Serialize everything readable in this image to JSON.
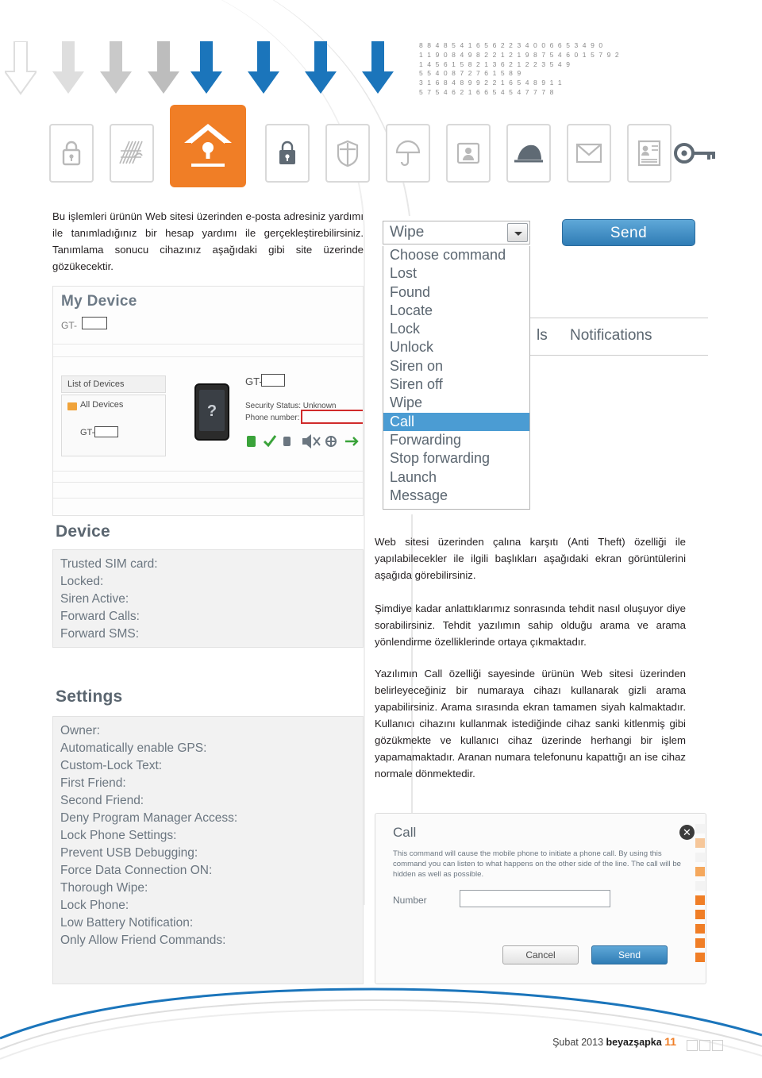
{
  "document": {
    "digits": [
      "8 8 4 8 5 4 1 6 5 6 2 2 3 4 0 0 6 6 5 3 4 9 0",
      "1 1 9 0 8 4 9 8 2 2 1 2 1 9 8 7 5 4 6 0 1 5 7 9 2",
      "1 4 5 6 1 5 8 2 1 3 6 2 1 2 2 3 5 4 9",
      "5 5 4 0 8 7 2 7 6 1 5 8 9",
      "3 1 6 8 4 8 9 9 2 2 1 6 5 4 8 9 1 1",
      "5 7 5 4 6 2 1 6 6 5 4 5 4 7 7 7 8"
    ],
    "icons": [
      "lock-icon",
      "maze-icon",
      "home-shield-icon",
      "padlock-icon",
      "shield-icon",
      "umbrella-icon",
      "portrait-folder-icon",
      "hat-icon",
      "envelope-icon",
      "id-card-icon",
      "key-icon"
    ],
    "intro": "Bu işlemleri ürünün Web sitesi üzerinden e-posta adresiniz yardımı ile tanımladığınız bir hesap yardımı ile gerçekleştirebilirsiniz. Tanımlama sonucu cihazınız aşağıdaki gibi site üzerinde gözükecektir.",
    "paragraphs": [
      "Web sitesi üzerinden çalına karşıtı (Anti Theft) özelliği ile yapılabilecekler ile ilgili başlıkları aşağıdaki ekran görüntülerini aşağıda görebilirsiniz.",
      "Şimdiye kadar anlattıklarımız sonrasında tehdit nasıl oluşuyor diye sorabilirsiniz. Tehdit yazılımın sahip olduğu arama ve arama yönlendirme özelliklerinde ortaya çıkmaktadır.",
      "Yazılımın Call özelliği sayesinde ürünün Web sitesi üzerinden belirleyeceğiniz bir numaraya cihazı kullanarak gizli arama yapabilirsiniz. Arama sırasında ekran tamamen siyah kalmaktadır. Kullanıcı cihazını kullanmak istediğinde cihaz sanki kitlenmiş gibi gözükmekte ve kullanıcı cihaz üzerinde herhangi bir işlem yapamamaktadır. Aranan numara telefonunu kapattığı an ise cihaz normale dönmektedir."
    ]
  },
  "screenshot_devices": {
    "title": "My Device",
    "subtitle": "GT-",
    "panel_header": "List of Devices",
    "all_devices": "All Devices",
    "device_item": "GT-",
    "phone_label": "GT-",
    "security_status": "Security Status: Unknown",
    "phone_number": "Phone number:"
  },
  "screenshot_dropdown": {
    "selected_value": "Wipe",
    "send_button": "Send",
    "options": [
      "Choose command",
      "Lost",
      "Found",
      "Locate",
      "Lock",
      "Unlock",
      "Siren on",
      "Siren off",
      "Wipe",
      "Call",
      "Forwarding",
      "Stop forwarding",
      "Launch",
      "Message"
    ],
    "highlighted_option": "Call",
    "tab_partial": "ls",
    "tab_notifications": "Notifications"
  },
  "screenshot_device_settings": {
    "device_header": "Device",
    "device_rows": [
      "Trusted SIM card:",
      "Locked:",
      "Siren Active:",
      "Forward Calls:",
      "Forward SMS:"
    ],
    "settings_header": "Settings",
    "settings_rows": [
      "Owner:",
      "Automatically enable GPS:",
      "Custom-Lock Text:",
      "First Friend:",
      "Second Friend:",
      "Deny Program Manager Access:",
      "Lock Phone Settings:",
      "Prevent USB Debugging:",
      "Force Data Connection ON:",
      "Thorough Wipe:",
      "Lock Phone:",
      "Low Battery Notification:",
      "Only Allow Friend Commands:"
    ]
  },
  "screenshot_call_dialog": {
    "title": "Call",
    "close_icon": "close-icon",
    "body": "This command will cause the mobile phone to initiate a phone call. By using this command you can listen to what happens on the other side of the line. The call will be hidden as well as possible.",
    "number_label": "Number",
    "number_value": "",
    "cancel_button": "Cancel",
    "send_button": "Send"
  },
  "footer": {
    "date": "Şubat 2013 ",
    "brand": "beyazşapka",
    "page": "11"
  },
  "colors": {
    "accent_orange": "#f07e26",
    "blue": "#1b75bb",
    "gray_text": "#6b7680"
  }
}
